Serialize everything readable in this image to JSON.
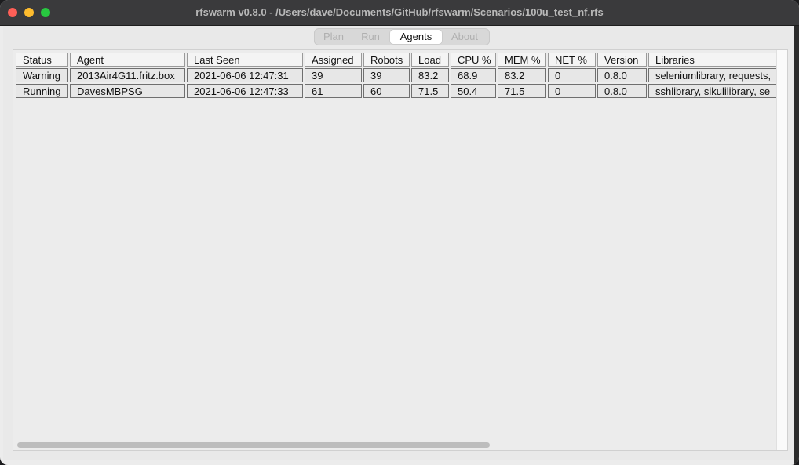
{
  "window": {
    "title": "rfswarm v0.8.0 - /Users/dave/Documents/GitHub/rfswarm/Scenarios/100u_test_nf.rfs"
  },
  "tabs": [
    {
      "label": "Plan",
      "active": false
    },
    {
      "label": "Run",
      "active": false
    },
    {
      "label": "Agents",
      "active": true
    },
    {
      "label": "About",
      "active": false
    }
  ],
  "agents_table": {
    "columns": [
      "Status",
      "Agent",
      "Last Seen",
      "Assigned",
      "Robots",
      "Load",
      "CPU %",
      "MEM %",
      "NET %",
      "Version",
      "Libraries"
    ],
    "rows": [
      [
        "Warning",
        "2013Air4G11.fritz.box",
        "2021-06-06 12:47:31",
        "39",
        "39",
        "83.2",
        "68.9",
        "83.2",
        "0",
        "0.8.0",
        "seleniumlibrary, requests,"
      ],
      [
        "Running",
        "DavesMBPSG",
        "2021-06-06 12:47:33",
        "61",
        "60",
        "71.5",
        "50.4",
        "71.5",
        "0",
        "0.8.0",
        "sshlibrary, sikulilibrary, se"
      ]
    ]
  },
  "colors": {
    "close": "#fe5f57",
    "minimize": "#febc2e",
    "maximize": "#28c840"
  }
}
